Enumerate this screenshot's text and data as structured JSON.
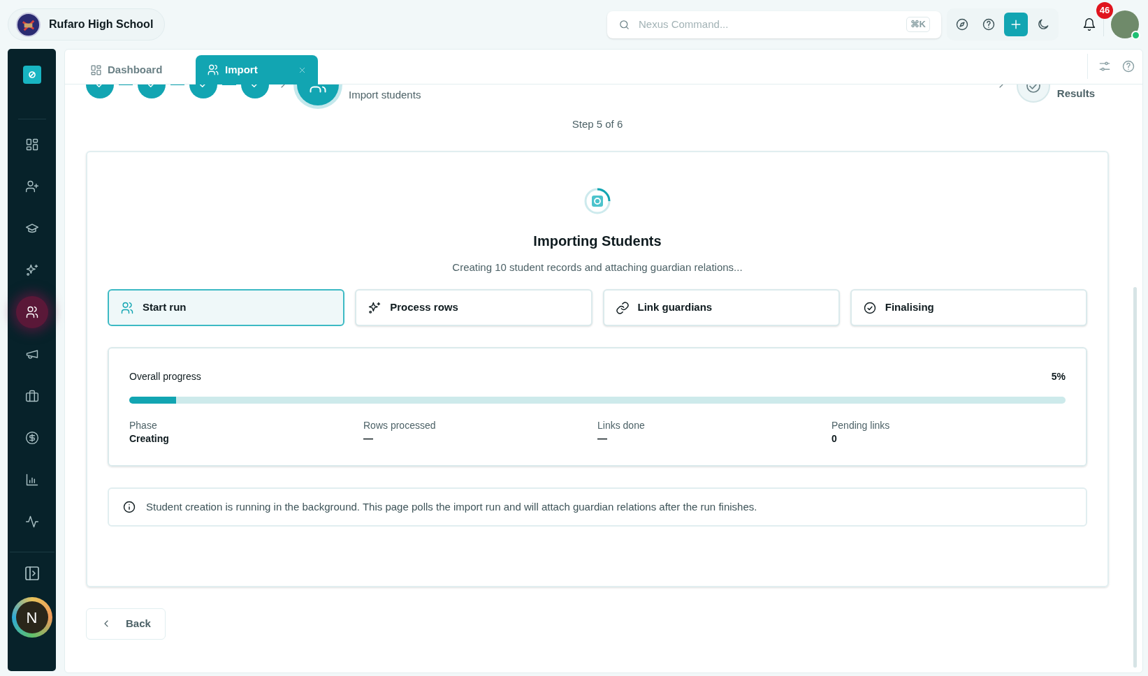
{
  "header": {
    "school_name": "Rufaro High School",
    "search": {
      "placeholder": "Nexus Command...",
      "shortcut": "⌘K"
    },
    "notification_count": "46"
  },
  "sidebar": {
    "items": [
      {
        "selected": false
      },
      {
        "selected": false
      },
      {
        "selected": false
      },
      {
        "selected": false
      },
      {
        "selected": true
      },
      {
        "selected": false
      },
      {
        "selected": false
      },
      {
        "selected": false
      },
      {
        "selected": false
      },
      {
        "selected": false
      }
    ],
    "user_initial": "N"
  },
  "tabs": [
    {
      "label": "Dashboard",
      "selected": false
    },
    {
      "label": "Import",
      "selected": true
    }
  ],
  "stepper": {
    "steps": [
      {
        "done": true,
        "current": false
      },
      {
        "done": true,
        "current": false
      },
      {
        "done": true,
        "current": false
      },
      {
        "done": true,
        "current": false
      },
      {
        "done": false,
        "current": true,
        "subtitle": "Import students"
      },
      {
        "done": false,
        "current": false,
        "label": "Results"
      }
    ],
    "caption": "Step 5 of 6"
  },
  "import": {
    "title": "Importing Students",
    "subtitle": "Creating 10 student records and attaching guardian relations...",
    "phases": [
      {
        "label": "Start run",
        "selected": true
      },
      {
        "label": "Process rows",
        "selected": false
      },
      {
        "label": "Link guardians",
        "selected": false
      },
      {
        "label": "Finalising",
        "selected": false
      }
    ],
    "progress": {
      "label": "Overall progress",
      "reading": "5%",
      "level": 0.05
    },
    "stats": [
      {
        "label": "Phase",
        "value": "Creating"
      },
      {
        "label": "Rows processed",
        "value": "—"
      },
      {
        "label": "Links done",
        "value": "—"
      },
      {
        "label": "Pending links",
        "value": "0"
      }
    ],
    "info": "Student creation is running in the background. This page polls the import run and will attach guardian relations after the run finishes."
  },
  "back_button": "Back"
}
